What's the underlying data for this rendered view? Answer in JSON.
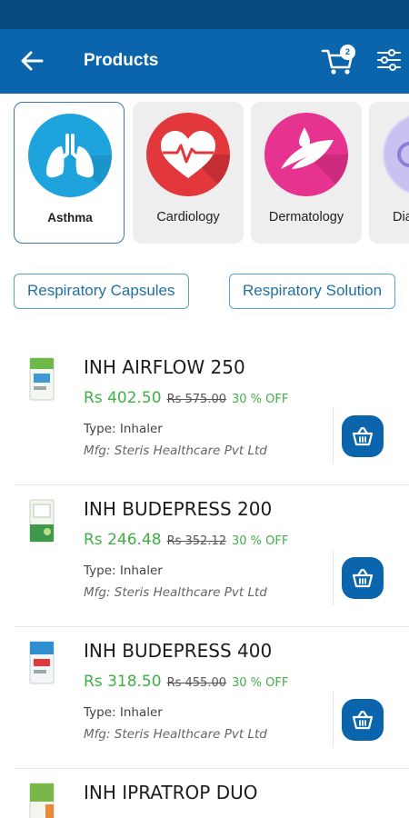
{
  "header": {
    "title": "Products",
    "cart_count": "2",
    "back_icon": "arrow-left-icon",
    "cart_icon": "cart-icon",
    "filter_icon": "sliders-icon",
    "bar_color": "#0a65ad",
    "status_color": "#064a80"
  },
  "categories": [
    {
      "label": "Asthma",
      "icon": "lungs-icon",
      "color": "#1ea3dc",
      "selected": true
    },
    {
      "label": "Cardiology",
      "icon": "heart-pulse-icon",
      "color": "#e2383c",
      "selected": false
    },
    {
      "label": "Dermatology",
      "icon": "feather-drop-icon",
      "color": "#e6338f",
      "selected": false
    },
    {
      "label": "Dia",
      "icon": "diabetes-icon",
      "color": "#8b7fd6",
      "selected": false
    }
  ],
  "chips": [
    {
      "label": "Respiratory Capsules"
    },
    {
      "label": "Respiratory Solution"
    }
  ],
  "products": [
    {
      "name": "INH AIRFLOW 250",
      "price": "Rs 402.50",
      "mrp": "Rs 575.00",
      "discount": "30 % OFF",
      "type": "Type: Inhaler",
      "mfg": "Mfg: Steris Healthcare Pvt Ltd"
    },
    {
      "name": "INH BUDEPRESS 200",
      "price": "Rs 246.48",
      "mrp": "Rs 352.12",
      "discount": "30 % OFF",
      "type": "Type: Inhaler",
      "mfg": "Mfg: Steris Healthcare Pvt Ltd"
    },
    {
      "name": "INH BUDEPRESS 400",
      "price": "Rs 318.50",
      "mrp": "Rs 455.00",
      "discount": "30 % OFF",
      "type": "Type: Inhaler",
      "mfg": "Mfg: Steris Healthcare Pvt Ltd"
    },
    {
      "name": "INH IPRATROP DUO",
      "price": "",
      "mrp": "",
      "discount": "",
      "type": "",
      "mfg": ""
    }
  ],
  "colors": {
    "price_green": "#3fb046",
    "chip_border": "#5aa0c8",
    "accent_blue": "#0a65ad"
  }
}
